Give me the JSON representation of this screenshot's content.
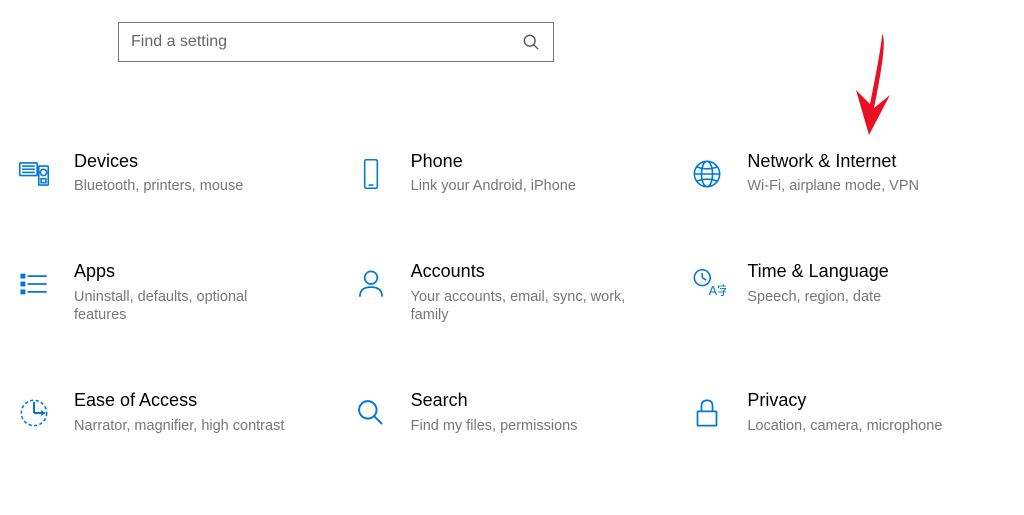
{
  "search": {
    "placeholder": "Find a setting"
  },
  "accent_color": "#0078d7",
  "categories": [
    {
      "title": "Devices",
      "desc": "Bluetooth, printers, mouse"
    },
    {
      "title": "Phone",
      "desc": "Link your Android, iPhone"
    },
    {
      "title": "Network & Internet",
      "desc": "Wi-Fi, airplane mode, VPN"
    },
    {
      "title": "Apps",
      "desc": "Uninstall, defaults, optional features"
    },
    {
      "title": "Accounts",
      "desc": "Your accounts, email, sync, work, family"
    },
    {
      "title": "Time & Language",
      "desc": "Speech, region, date"
    },
    {
      "title": "Ease of Access",
      "desc": "Narrator, magnifier, high contrast"
    },
    {
      "title": "Search",
      "desc": "Find my files, permissions"
    },
    {
      "title": "Privacy",
      "desc": "Location, camera, microphone"
    }
  ]
}
